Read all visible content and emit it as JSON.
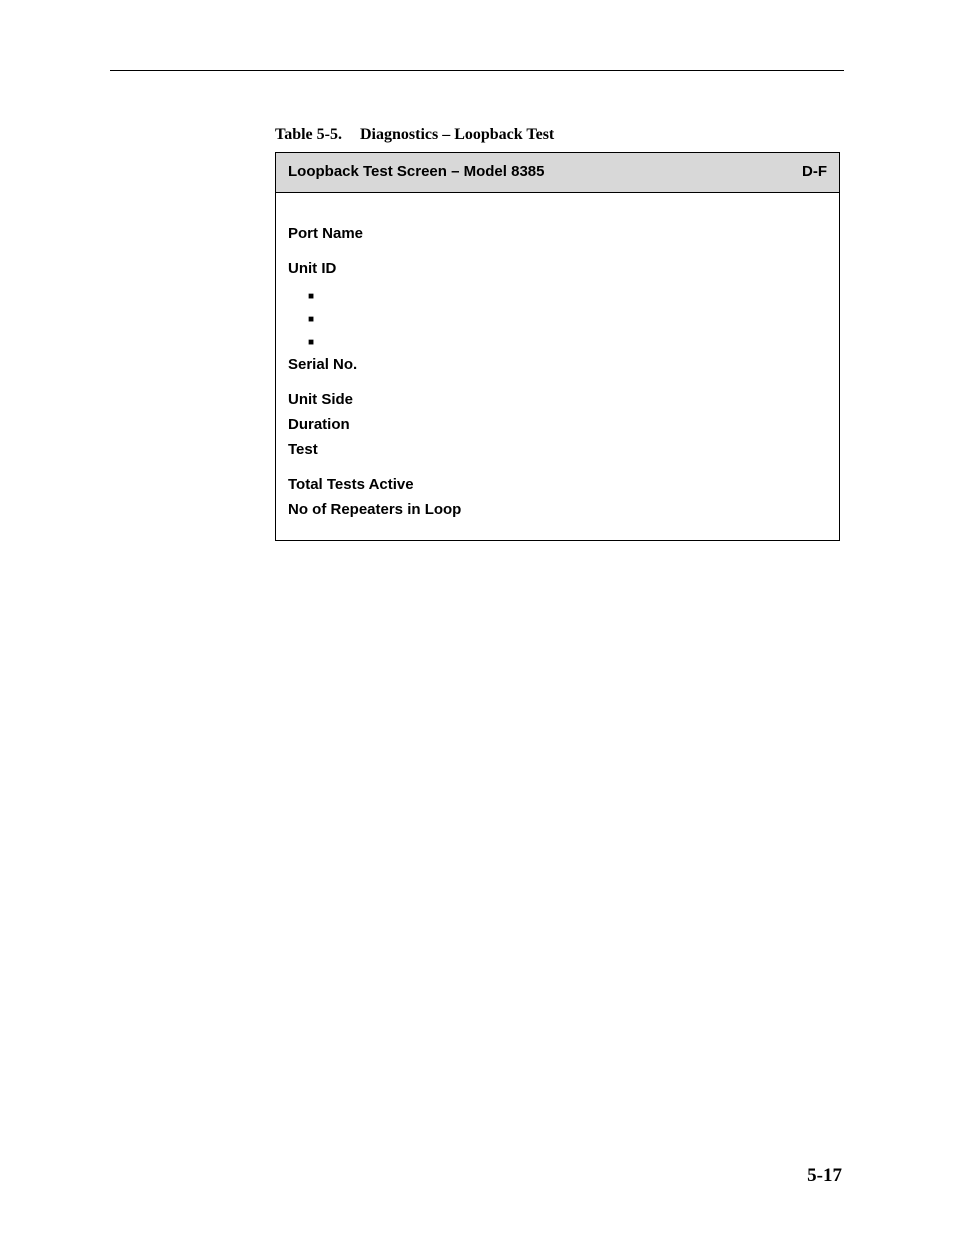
{
  "caption": {
    "number": "Table 5-5.",
    "title": "Diagnostics – Loopback Test"
  },
  "table": {
    "header": {
      "title": "Loopback Test Screen – Model 8385",
      "right": "D-F"
    },
    "fields": {
      "port_name": "Port Name",
      "unit_id": "Unit ID",
      "serial_no": "Serial No.",
      "unit_side": "Unit Side",
      "duration": "Duration",
      "test": "Test",
      "total_tests_active": "Total Tests Active",
      "no_of_repeaters": "No of Repeaters in Loop"
    }
  },
  "page_number": "5-17"
}
